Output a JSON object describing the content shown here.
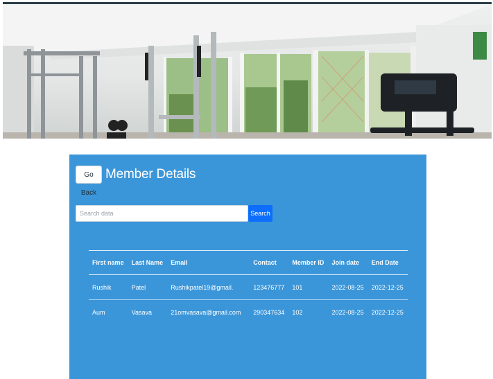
{
  "header": {
    "go_back_label": "Go Back",
    "title": "Member Details"
  },
  "search": {
    "placeholder": "Search data",
    "button_label": "Search"
  },
  "table": {
    "columns": [
      "First name",
      "Last Name",
      "Email",
      "Contact",
      "Member ID",
      "Join date",
      "End Date"
    ],
    "rows": [
      [
        "Rushik",
        "Patel",
        "Rushikpatel19@gmail.",
        "123476777",
        "101",
        "2022-08-25",
        "2022-12-25"
      ],
      [
        "Aum",
        "Vasava",
        "21omvasava@gmail.com",
        "290347634",
        "102",
        "2022-08-25",
        "2022-12-25"
      ]
    ]
  },
  "colors": {
    "panel_background": "#3b96d9",
    "search_button": "#0d6efd",
    "text_on_panel": "#ffffff"
  }
}
